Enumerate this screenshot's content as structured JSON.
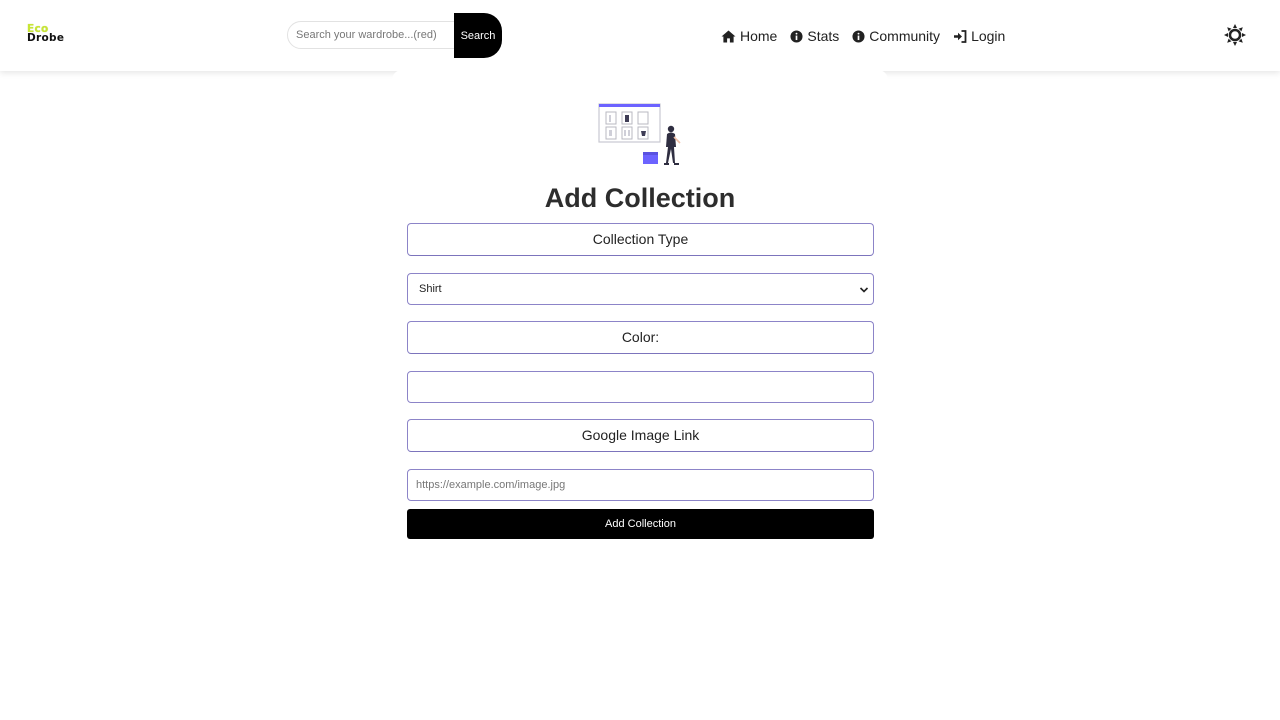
{
  "header": {
    "logo": {
      "line1": "Eco",
      "line2": "Drobe"
    },
    "search": {
      "placeholder": "Search your wardrobe...(red)",
      "value": "",
      "button_label": "Search"
    },
    "nav": [
      {
        "label": "Home",
        "icon": "home-icon"
      },
      {
        "label": "Stats",
        "icon": "info-circle-icon"
      },
      {
        "label": "Community",
        "icon": "info-circle-icon"
      },
      {
        "label": "Login",
        "icon": "sign-in-icon"
      }
    ],
    "theme_toggle_icon": "sun-icon"
  },
  "form": {
    "illustration": "wardrobe-illustration",
    "title": "Add Collection",
    "collection_type_label": "Collection Type",
    "collection_type_selected": "Shirt",
    "color_label": "Color:",
    "color_value": "",
    "image_link_label": "Google Image Link",
    "image_link_placeholder": "https://example.com/image.jpg",
    "image_link_value": "",
    "submit_label": "Add Collection"
  },
  "colors": {
    "logo_accent": "#c8e635",
    "field_border": "#8c84c8",
    "primary_button": "#000000",
    "illustration_accent": "#6c63ff"
  }
}
